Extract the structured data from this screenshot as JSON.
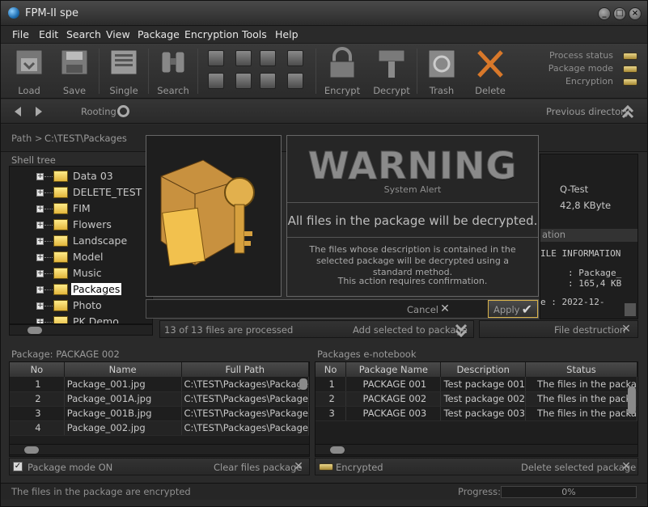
{
  "window": {
    "title": "FPM-II spe"
  },
  "menu": [
    "File",
    "Edit",
    "Search",
    "View",
    "Package",
    "Encryption",
    "Tools",
    "Help"
  ],
  "toolbar": {
    "load": "Load",
    "save": "Save",
    "single": "Single",
    "search": "Search",
    "encrypt": "Encrypt",
    "decrypt": "Decrypt",
    "trash": "Trash",
    "delete": "Delete"
  },
  "status_indicators": [
    "Process status",
    "Package mode",
    "Encryption"
  ],
  "nav": {
    "rooting": "Rooting",
    "previous_directory": "Previous directory"
  },
  "path": {
    "label": "Path  >",
    "value": "C:\\TEST\\Packages"
  },
  "shell_tree": {
    "header": "Shell tree",
    "items": [
      "Data 03",
      "DELETE_TEST",
      "FIM",
      "Flowers",
      "Landscape",
      "Model",
      "Music",
      "Packages",
      "Photo",
      "PK Demo"
    ],
    "selected": "Packages"
  },
  "right_info": {
    "name": "Q-Test",
    "size": "42,8 KByte",
    "section": "ation",
    "file_info_header": "ILE INFORMATION",
    "line1": ": Package_",
    "line2": ": 165,4 KB",
    "line3": "e    : 2022-12-"
  },
  "files_bar": {
    "processed": "13 of 13 files are processed",
    "add_selected": "Add selected to package",
    "file_destruction": "File destruction"
  },
  "package_table": {
    "header": "Package: PACKAGE 002",
    "columns": [
      "No",
      "Name",
      "Full Path"
    ],
    "rows": [
      [
        "1",
        "Package_001.jpg",
        "C:\\TEST\\Packages\\Package"
      ],
      [
        "2",
        "Package_001A.jpg",
        "C:\\TEST\\Packages\\Package"
      ],
      [
        "3",
        "Package_001B.jpg",
        "C:\\TEST\\Packages\\Package"
      ],
      [
        "4",
        "Package_002.jpg",
        "C:\\TEST\\Packages\\Package"
      ]
    ]
  },
  "notebook_table": {
    "header": "Packages e-notebook",
    "columns": [
      "No",
      "Package Name",
      "Description",
      "Status"
    ],
    "rows": [
      [
        "1",
        "PACKAGE 001",
        "Test package 001",
        "The files in the packa"
      ],
      [
        "2",
        "PACKAGE 002",
        "Test package 002",
        "The files in the packa"
      ],
      [
        "3",
        "PACKAGE 003",
        "Test package 003",
        "The files in the packa"
      ]
    ]
  },
  "left_bottom": {
    "package_mode": "Package mode ON",
    "clear": "Clear files package"
  },
  "right_bottom": {
    "encrypted": "Encrypted",
    "delete_selected": "Delete selected  package"
  },
  "statusbar": {
    "message": "The files in the package are encrypted",
    "progress_label": "Progress:",
    "progress_value": "0%"
  },
  "dialog": {
    "title": "WARNING",
    "subtitle": "System Alert",
    "headline": "All files in the package will be decrypted.",
    "body": "The files whose description is contained in the selected package will be decrypted using a standard method.",
    "confirm": "This action requires confirmation.",
    "cancel": "Cancel",
    "apply": "Apply"
  },
  "colors": {
    "accent": "#d8b24a",
    "background": "#2a2a2a",
    "led": "#e9d58a"
  }
}
